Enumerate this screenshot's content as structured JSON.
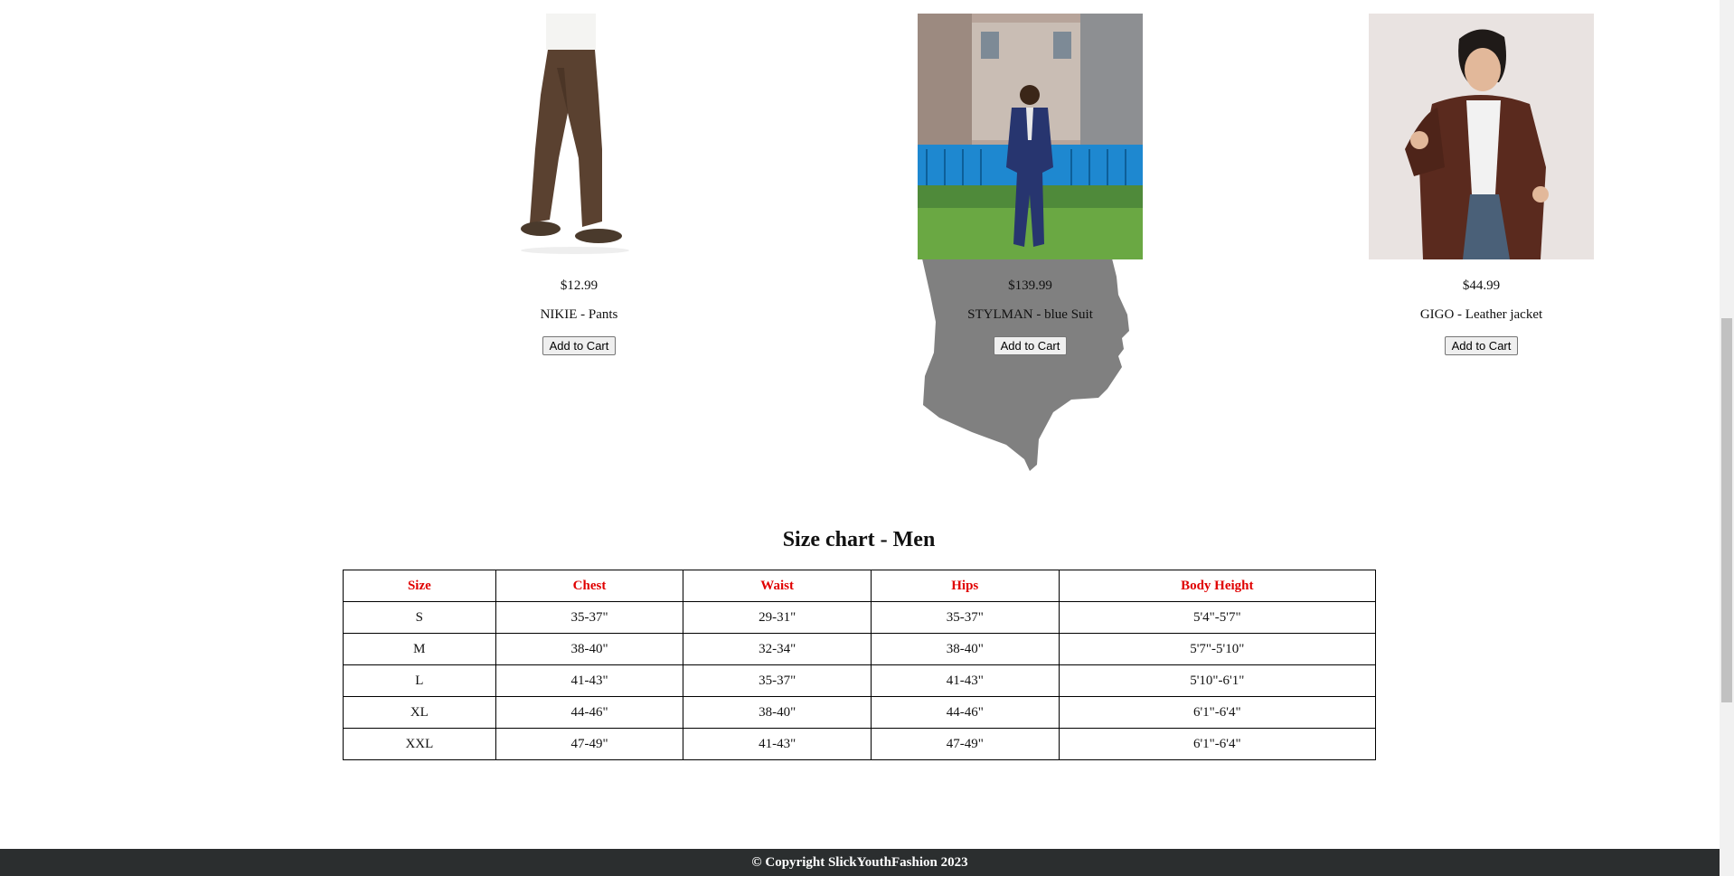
{
  "products": [
    {
      "price": "$12.99",
      "name": "NIKIE - Pants",
      "button": "Add to Cart"
    },
    {
      "price": "$139.99",
      "name": "STYLMAN - blue Suit",
      "button": "Add to Cart"
    },
    {
      "price": "$44.99",
      "name": "GIGO - Leather jacket",
      "button": "Add to Cart"
    }
  ],
  "size_chart": {
    "title": "Size chart - Men",
    "headers": [
      "Size",
      "Chest",
      "Waist",
      "Hips",
      "Body Height"
    ],
    "rows": [
      [
        "S",
        "35-37\"",
        "29-31\"",
        "35-37\"",
        "5'4\"-5'7\""
      ],
      [
        "M",
        "38-40\"",
        "32-34\"",
        "38-40\"",
        "5'7\"-5'10\""
      ],
      [
        "L",
        "41-43\"",
        "35-37\"",
        "41-43\"",
        "5'10\"-6'1\""
      ],
      [
        "XL",
        "44-46\"",
        "38-40\"",
        "44-46\"",
        "6'1\"-6'4\""
      ],
      [
        "XXL",
        "47-49\"",
        "41-43\"",
        "47-49\"",
        "6'1\"-6'4\""
      ]
    ]
  },
  "footer": {
    "text": "© Copyright SlickYouthFashion 2023"
  },
  "colors": {
    "header_text": "#e00000",
    "footer_bg": "#2b2e2f",
    "silhouette": "#808080"
  }
}
